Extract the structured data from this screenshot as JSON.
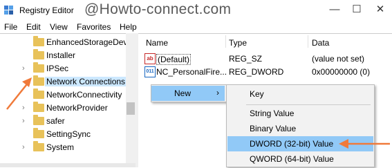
{
  "window": {
    "title": "Registry Editor",
    "watermark": "@Howto-connect.com",
    "minimize": "—",
    "maximize": "☐",
    "close": "✕"
  },
  "menu": [
    "File",
    "Edit",
    "View",
    "Favorites",
    "Help"
  ],
  "tree": {
    "items": [
      {
        "label": "EnhancedStorageDev",
        "expandable": false,
        "selected": false
      },
      {
        "label": "Installer",
        "expandable": false,
        "selected": false
      },
      {
        "label": "IPSec",
        "expandable": true,
        "selected": false
      },
      {
        "label": "Network Connections",
        "expandable": false,
        "selected": true
      },
      {
        "label": "NetworkConnectivity",
        "expandable": false,
        "selected": false
      },
      {
        "label": "NetworkProvider",
        "expandable": true,
        "selected": false
      },
      {
        "label": "safer",
        "expandable": true,
        "selected": false
      },
      {
        "label": "SettingSync",
        "expandable": false,
        "selected": false
      },
      {
        "label": "System",
        "expandable": true,
        "selected": false
      }
    ],
    "chevron": "›"
  },
  "list": {
    "headers": {
      "name": "Name",
      "type": "Type",
      "data": "Data"
    },
    "rows": [
      {
        "name": "(Default)",
        "type": "REG_SZ",
        "data": "(value not set)",
        "icon": "ab"
      },
      {
        "name": "NC_PersonalFire...",
        "type": "REG_DWORD",
        "data": "0x00000000 (0)",
        "icon": "011"
      }
    ]
  },
  "context_menu": {
    "new_label": "New",
    "submenu_arrow": "›",
    "submenu": {
      "key": "Key",
      "items": [
        "String Value",
        "Binary Value",
        "DWORD (32-bit) Value",
        "QWORD (64-bit) Value"
      ],
      "highlighted": "DWORD (32-bit) Value"
    }
  },
  "colors": {
    "selection": "#cce8ff",
    "menu_highlight": "#91c9f7",
    "folder": "#e8c25a",
    "arrow": "#f07a3a"
  }
}
